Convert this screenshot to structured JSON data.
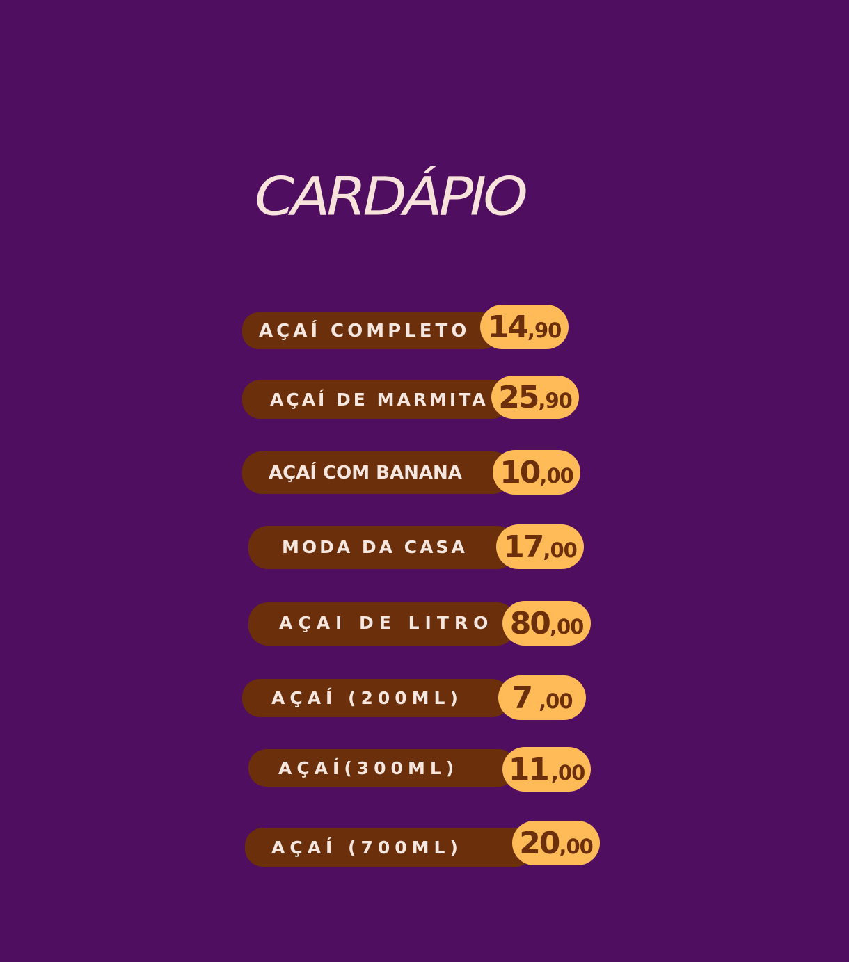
{
  "title": "CARDÁPIO",
  "colors": {
    "background": "#500e60",
    "bar": "#6b300b",
    "pill": "#ffbb57",
    "text_light": "#f5e6df",
    "text_dark": "#6b300b"
  },
  "menu": [
    {
      "name": "AÇAÍ  COMPLETO",
      "price_int": "14",
      "price_dec": ",90"
    },
    {
      "name": "AÇAÍ DE MARMITA",
      "price_int": "25",
      "price_dec": ",90"
    },
    {
      "name": "AÇAÍ COM BANANA",
      "price_int": "10",
      "price_dec": ",00"
    },
    {
      "name": "MODA DA CASA",
      "price_int": "17",
      "price_dec": ",00"
    },
    {
      "name": "AÇAI DE LITRO",
      "price_int": "80",
      "price_dec": ",00"
    },
    {
      "name": "AÇAÍ  (200ML)",
      "price_int": "7",
      "price_dec": ",00"
    },
    {
      "name": "AÇAÍ(300ML)",
      "price_int": "11",
      "price_dec": ",00"
    },
    {
      "name": "AÇAÍ (700ML)",
      "price_int": "20",
      "price_dec": ",00"
    }
  ]
}
